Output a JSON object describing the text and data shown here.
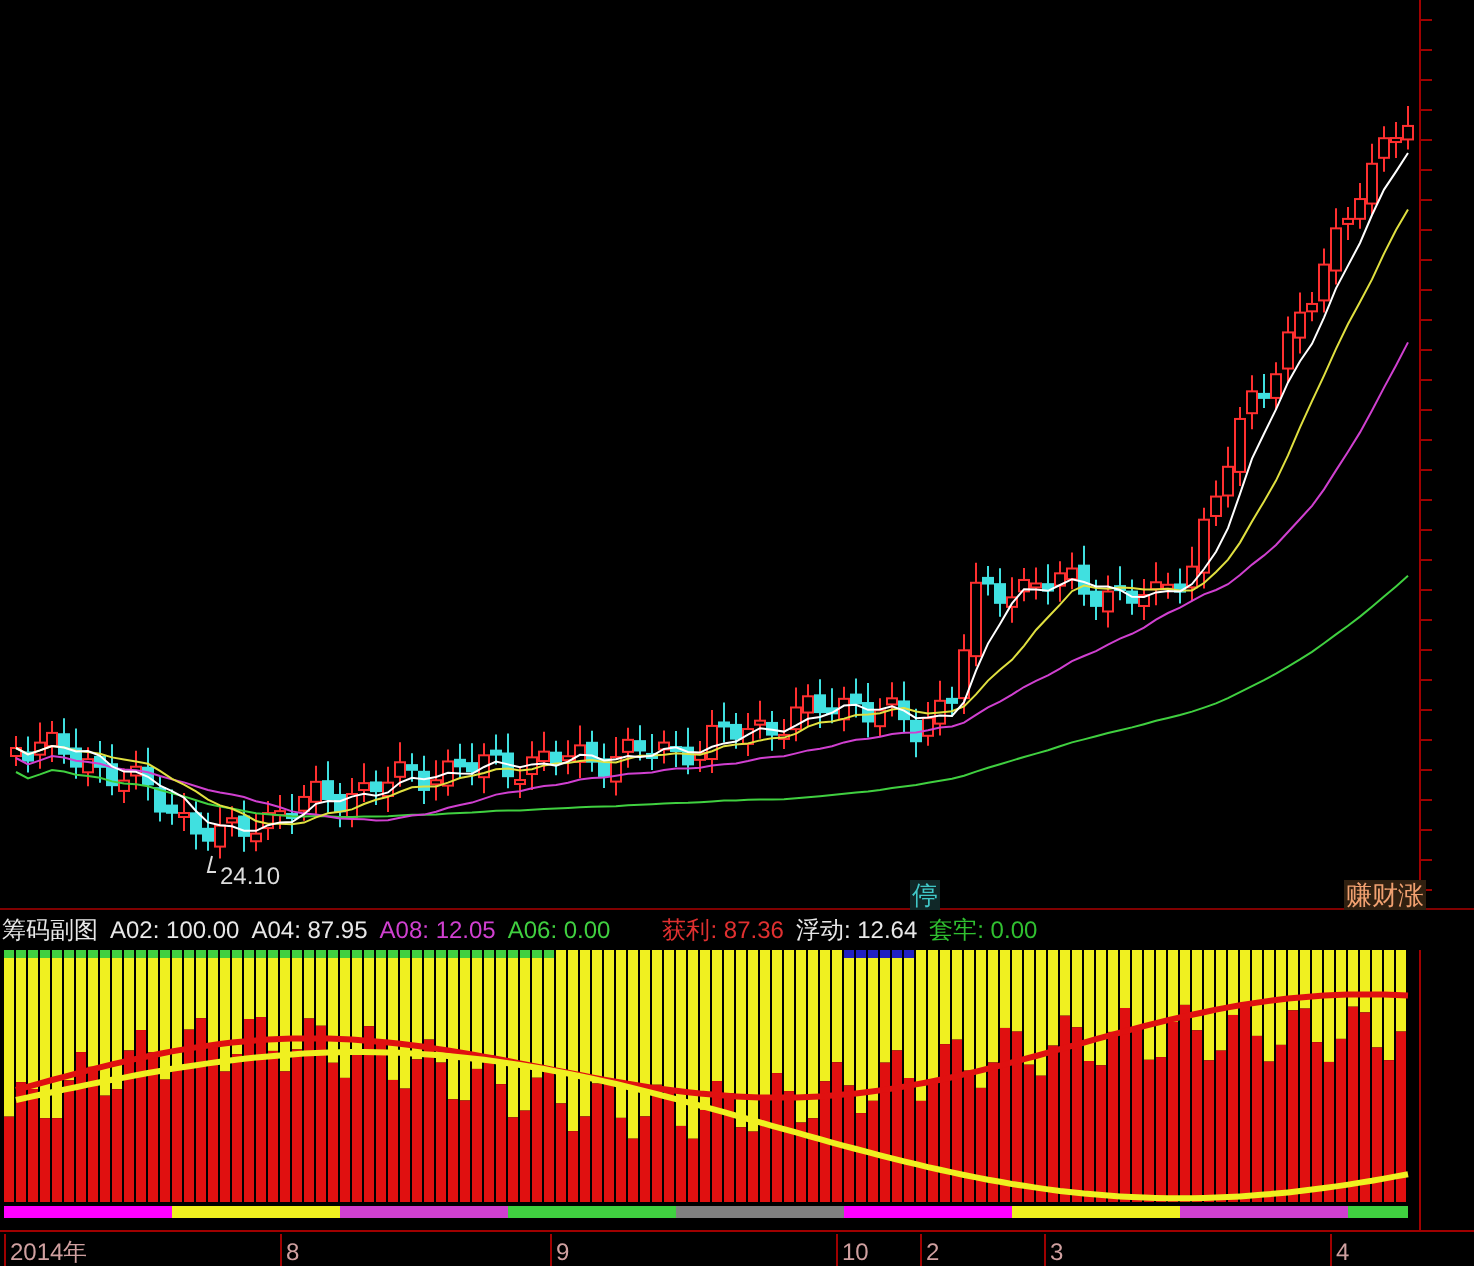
{
  "price_chart": {
    "low_label": "24.10",
    "signals": [
      {
        "text": "停",
        "kind": "stop"
      },
      {
        "text": "赚财涨",
        "kind": "gain"
      }
    ]
  },
  "indicator": {
    "title": "筹码副图",
    "legend": [
      {
        "text": "A02: 100.00",
        "color": "#e8e8e8"
      },
      {
        "text": "A04: 87.95",
        "color": "#e8e8e8"
      },
      {
        "text": "A08: 12.05",
        "color": "#d040d0"
      },
      {
        "text": "A06: 0.00",
        "color": "#40d040"
      },
      {
        "text": "获利: 87.36",
        "color": "#e03030"
      },
      {
        "text": "浮动: 12.64",
        "color": "#e8e8e8"
      },
      {
        "text": "套牢: 0.00",
        "color": "#30c030"
      }
    ]
  },
  "time_axis": [
    "2014年",
    "8",
    "9",
    "10",
    "2",
    "3",
    "4"
  ]
}
